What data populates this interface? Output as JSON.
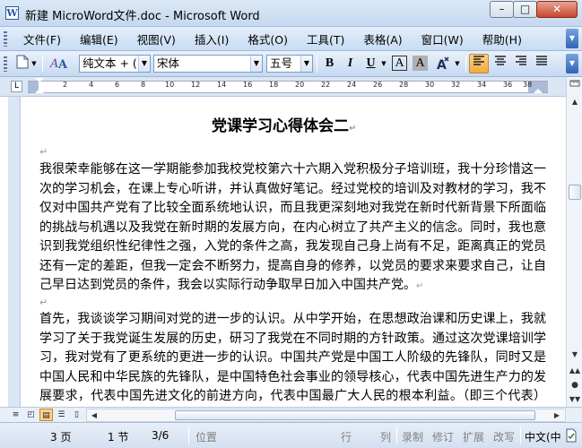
{
  "window": {
    "title": "新建 MicroWord文件.doc - Microsoft Word",
    "app_icon_glyph": "W",
    "minimize_glyph": "–",
    "maximize_glyph": "□",
    "close_glyph": "✕"
  },
  "menubar": {
    "items": [
      {
        "label": "文件(F)"
      },
      {
        "label": "编辑(E)"
      },
      {
        "label": "视图(V)"
      },
      {
        "label": "插入(I)"
      },
      {
        "label": "格式(O)"
      },
      {
        "label": "工具(T)"
      },
      {
        "label": "表格(A)"
      },
      {
        "label": "窗口(W)"
      },
      {
        "label": "帮助(H)"
      }
    ]
  },
  "toolbar": {
    "style_value": "纯文本 + (",
    "font_value": "宋体",
    "size_value": "五号",
    "bold_label": "B",
    "italic_label": "I",
    "underline_label": "U",
    "charborder_label": "A",
    "charshade_label": "A",
    "accent_color": "#f5a93a"
  },
  "ruler": {
    "numbers": [
      "2",
      "4",
      "6",
      "8",
      "10",
      "12",
      "14",
      "16",
      "18",
      "20",
      "22",
      "24",
      "26",
      "28",
      "30",
      "32",
      "34",
      "36",
      "38"
    ]
  },
  "document": {
    "title": "党课学习心得体会二",
    "paragraphs": [
      "我很荣幸能够在这一学期能参加我校党校第六十六期入党积极分子培训班，我十分珍惜这一次的学习机会，在课上专心听讲，并认真做好笔记。经过党校的培训及对教材的学习，我不仅对中国共产党有了比较全面系统地认识，而且我更深刻地对我党在新时代新背景下所面临的挑战与机遇以及我党在新时期的发展方向，在内心树立了共产主义的信念。同时，我也意识到我党组织性纪律性之强，入党的条件之高，我发现自己身上尚有不足，距离真正的党员还有一定的差距，但我一定会不断努力，提高自身的修养，以党员的要求来要求自己，让自己早日达到党员的条件，我会以实际行动争取早日加入中国共产党。",
      "首先，我谈谈学习期间对党的进一步的认识。从中学开始，在思想政治课和历史课上，我就学习了关于我党诞生发展的历史，研习了我党在不同时期的方针政策。通过这次党课培训学习，我对党有了更系统的更进一步的认识。中国共产党是中国工人阶级的先锋队，同时又是中国人民和中华民族的先锋队，是中国特色社会事业的领导核心，代表中国先进生产力的发展要求，代表中国先进文化的前进方向，代表中国最广大人民的根本利益。（即三个代表）这"
    ],
    "paragraph_mark": "↵"
  },
  "statusbar": {
    "page": "3 页",
    "section": "1 节",
    "page_of": "3/6",
    "at": "位置",
    "line": "行",
    "col": "列",
    "rec": "录制",
    "trk": "修订",
    "ext": "扩展",
    "ovr": "改写",
    "language": "中文(中"
  }
}
